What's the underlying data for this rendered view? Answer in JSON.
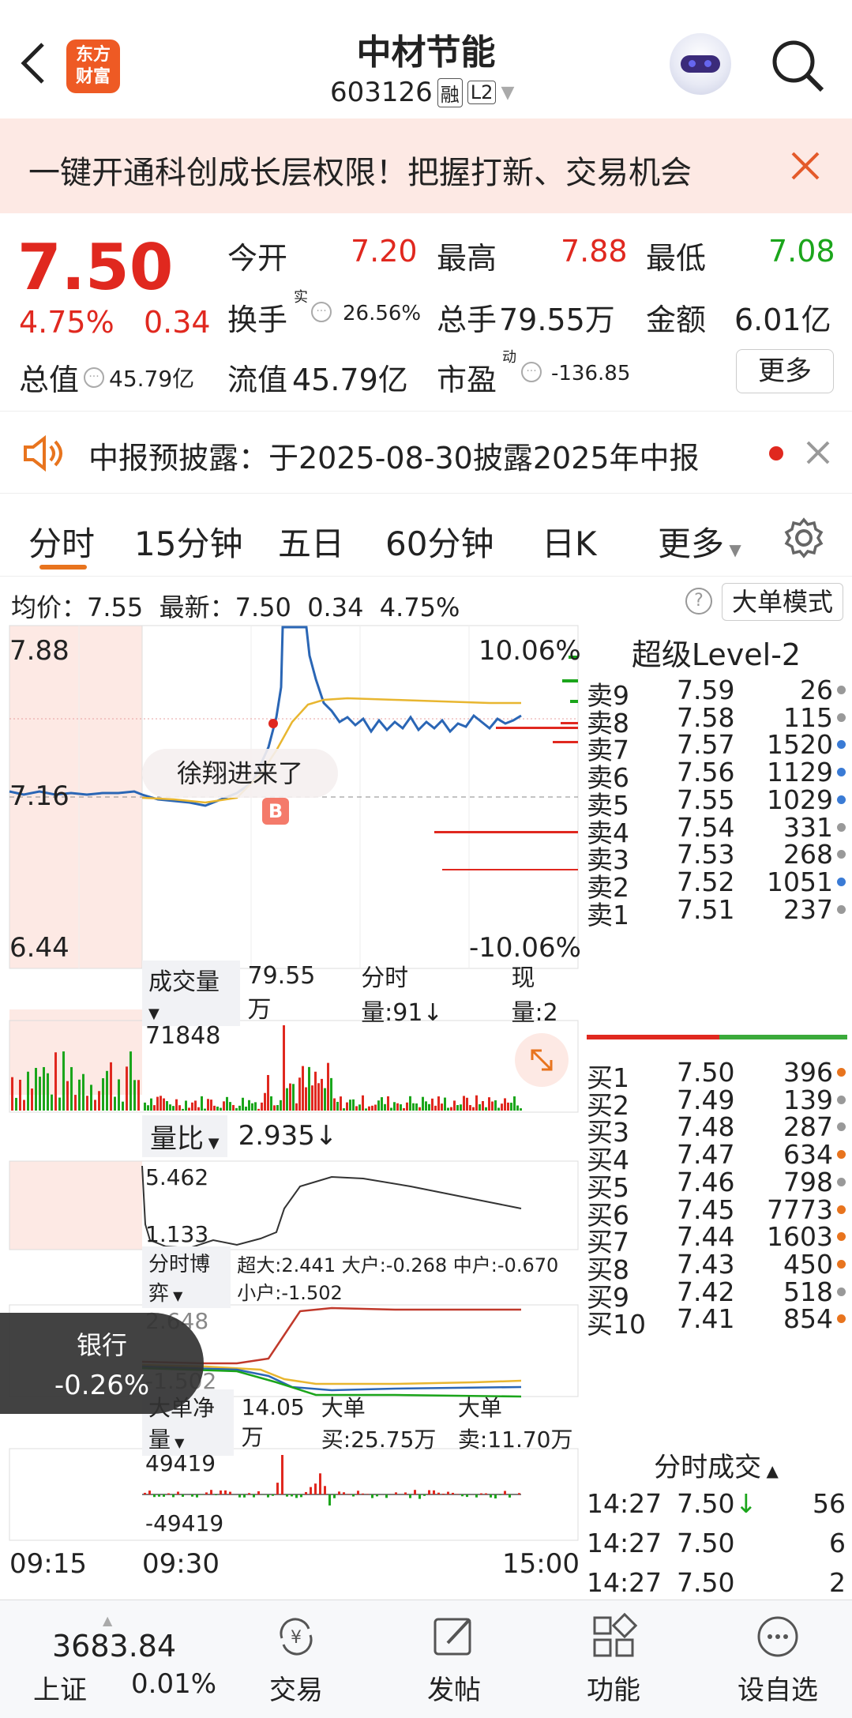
{
  "header": {
    "logo_line1": "东方",
    "logo_line2": "财富",
    "stock_name": "中材节能",
    "stock_code": "603126",
    "badge_margin": "融",
    "badge_level": "L2"
  },
  "banner": {
    "text": "一键开通科创成长层权限！把握打新、交易机会"
  },
  "quote": {
    "price": "7.50",
    "change_pct": "4.75%",
    "change_amt": "0.34",
    "open_label": "今开",
    "open": "7.20",
    "high_label": "最高",
    "high": "7.88",
    "low_label": "最低",
    "low": "7.08",
    "turnover_label": "换手",
    "turnover_sup": "实",
    "turnover": "26.56%",
    "volume_label": "总手",
    "volume": "79.55万",
    "amount_label": "金额",
    "amount": "6.01亿",
    "mktcap_label": "总值",
    "mktcap": "45.79亿",
    "float_label": "流值",
    "float": "45.79亿",
    "pe_label": "市盈",
    "pe_sup": "动",
    "pe": "-136.85",
    "more_button": "更多"
  },
  "notice": {
    "text": "中报预披露：于2025-08-30披露2025年中报"
  },
  "tabs": [
    "分时",
    "15分钟",
    "五日",
    "60分钟",
    "日K",
    "更多"
  ],
  "avg_line": {
    "text": "均价：7.55  最新：7.50  0.34  4.75%",
    "mode_button": "大单模式"
  },
  "chart": {
    "price_top": "7.88",
    "price_mid": "7.16",
    "price_bottom": "6.44",
    "pct_top": "10.06%",
    "pct_bottom": "-10.06%",
    "comment_bubble": "徐翔进来了",
    "buy_marker": "B",
    "vol_selector": "成交量",
    "vol_total": "79.55万",
    "vol_minute": "分时量:91↓",
    "vol_now": "现量:2",
    "vol_max": "71848",
    "ratio_selector": "量比",
    "ratio_value": "2.935↓",
    "ratio_top": "5.462",
    "ratio_bottom": "1.133",
    "game_selector": "分时博弈",
    "game_values": "超大:2.441 大户:-0.268 中户:-0.670 小户:-1.502",
    "game_top": "2.648",
    "game_bottom": "-1.502",
    "net_selector": "大单净量",
    "net_total": "14.05万",
    "net_buy": "大单买:25.75万",
    "net_sell": "大单卖:11.70万",
    "net_top": "49419",
    "net_bottom": "-49419",
    "time_start": "09:15",
    "time_open": "09:30",
    "time_end": "15:00"
  },
  "sector_toast": {
    "name": "银行",
    "change": "-0.26%"
  },
  "book": {
    "title": "超级Level-2",
    "asks": [
      {
        "label": "卖9",
        "price": "7.59",
        "vol": "26",
        "dot": "#999"
      },
      {
        "label": "卖8",
        "price": "7.58",
        "vol": "115",
        "dot": "#999"
      },
      {
        "label": "卖7",
        "price": "7.57",
        "vol": "1520",
        "dot": "#3a7bd5"
      },
      {
        "label": "卖6",
        "price": "7.56",
        "vol": "1129",
        "dot": "#3a7bd5"
      },
      {
        "label": "卖5",
        "price": "7.55",
        "vol": "1029",
        "dot": "#3a7bd5"
      },
      {
        "label": "卖4",
        "price": "7.54",
        "vol": "331",
        "dot": "#999"
      },
      {
        "label": "卖3",
        "price": "7.53",
        "vol": "268",
        "dot": "#999"
      },
      {
        "label": "卖2",
        "price": "7.52",
        "vol": "1051",
        "dot": "#3a7bd5"
      },
      {
        "label": "卖1",
        "price": "7.51",
        "vol": "237",
        "dot": "#999"
      }
    ],
    "bids": [
      {
        "label": "买1",
        "price": "7.50",
        "vol": "396",
        "dot": "#e8741e"
      },
      {
        "label": "买2",
        "price": "7.49",
        "vol": "139",
        "dot": "#999"
      },
      {
        "label": "买3",
        "price": "7.48",
        "vol": "287",
        "dot": "#999"
      },
      {
        "label": "买4",
        "price": "7.47",
        "vol": "634",
        "dot": "#e8741e"
      },
      {
        "label": "买5",
        "price": "7.46",
        "vol": "798",
        "dot": "#999"
      },
      {
        "label": "买6",
        "price": "7.45",
        "vol": "7773",
        "dot": "#e8741e"
      },
      {
        "label": "买7",
        "price": "7.44",
        "vol": "1603",
        "dot": "#e8741e"
      },
      {
        "label": "买8",
        "price": "7.43",
        "vol": "450",
        "dot": "#e8741e"
      },
      {
        "label": "买9",
        "price": "7.42",
        "vol": "518",
        "dot": "#999"
      },
      {
        "label": "买10",
        "price": "7.41",
        "vol": "854",
        "dot": "#e8741e"
      }
    ],
    "ticks_title": "分时成交",
    "ticks": [
      {
        "time": "14:27",
        "price": "7.50",
        "arrow": "↓",
        "vol": "56"
      },
      {
        "time": "14:27",
        "price": "7.50",
        "arrow": "",
        "vol": "6"
      },
      {
        "time": "14:27",
        "price": "7.50",
        "arrow": "",
        "vol": "2"
      }
    ]
  },
  "bottom": {
    "index_value": "3683.84",
    "index_name": "上证",
    "index_change": "0.01%",
    "nav": [
      "交易",
      "发帖",
      "功能",
      "设自选"
    ]
  }
}
